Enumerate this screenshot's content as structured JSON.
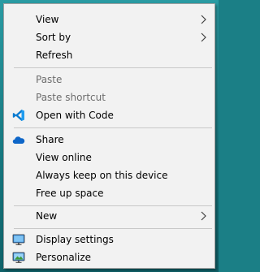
{
  "menu": {
    "items": {
      "view": "View",
      "sort_by": "Sort by",
      "refresh": "Refresh",
      "paste": "Paste",
      "paste_shortcut": "Paste shortcut",
      "open_with_code": "Open with Code",
      "share": "Share",
      "view_online": "View online",
      "always_keep": "Always keep on this device",
      "free_up_space": "Free up space",
      "new": "New",
      "display_settings": "Display settings",
      "personalize": "Personalize"
    },
    "disabled": [
      "paste",
      "paste_shortcut"
    ],
    "icons": {
      "open_with_code": "vscode-icon",
      "share": "onedrive-cloud-icon",
      "display_settings": "display-settings-icon",
      "personalize": "personalize-icon"
    },
    "submenus": [
      "view",
      "sort_by",
      "new"
    ]
  },
  "colors": {
    "menu_background": "#f2f2f2",
    "disabled_text": "#6d6d6d",
    "desktop": "#1b7f86",
    "vscode_blue": "#0a7ad0",
    "onedrive_blue": "#0e66c8"
  }
}
